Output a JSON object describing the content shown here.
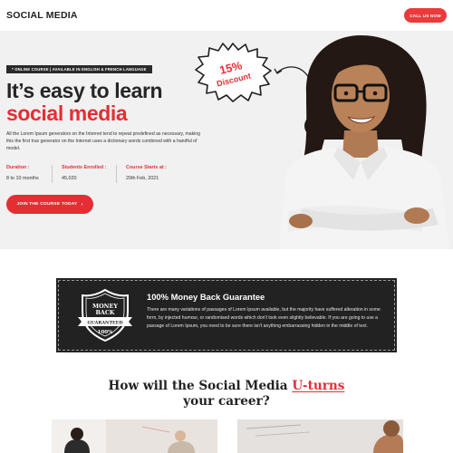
{
  "header": {
    "logo": "SOCIAL MEDIA",
    "call_button": "CALL US NOW"
  },
  "hero": {
    "badge": "* ONLINE COURSE | AVAILABLE IN ENGLISH & FRENCH LANGUAGE",
    "title_line1": "It’s easy to learn",
    "title_line2": "social media",
    "description": "All the Lorem Ipsum generators on the Internet tend to repeat predefined as necessary, making this the first true generator on the Internet uses a dictionary words combined with a handful of model.",
    "stats": [
      {
        "label": "Duration :",
        "value": "8 to 10 months"
      },
      {
        "label": "Students Enrolled :",
        "value": "45,020"
      },
      {
        "label": "Course Starts at :",
        "value": "20th Feb, 2021"
      }
    ],
    "cta": "JOIN THE COURSE TODAY",
    "cta_arrow": "›",
    "discount_percent": "15%",
    "discount_word": "Discount"
  },
  "guarantee": {
    "badge_line1": "MONEY",
    "badge_line2": "BACK",
    "badge_ribbon": "GUARANTEED",
    "badge_percent": "100%",
    "title": "100% Money Back Guarantee",
    "text": "There are many variations of passages of Lorem Ipsum available, but the majority have suffered alteration in some form, by injected humour, or randomised words which don't look even slightly believable. If you are going to use a passage of Lorem Ipsum, you need to be sure there isn't anything embarrassing hidden in the middle of text."
  },
  "section": {
    "heading_pre": "How will the Social Media ",
    "heading_accent": "U-turns",
    "heading_post": "your career?"
  },
  "colors": {
    "accent": "#e42e34",
    "dark": "#222222",
    "hero_bg": "#f1f1f1"
  }
}
